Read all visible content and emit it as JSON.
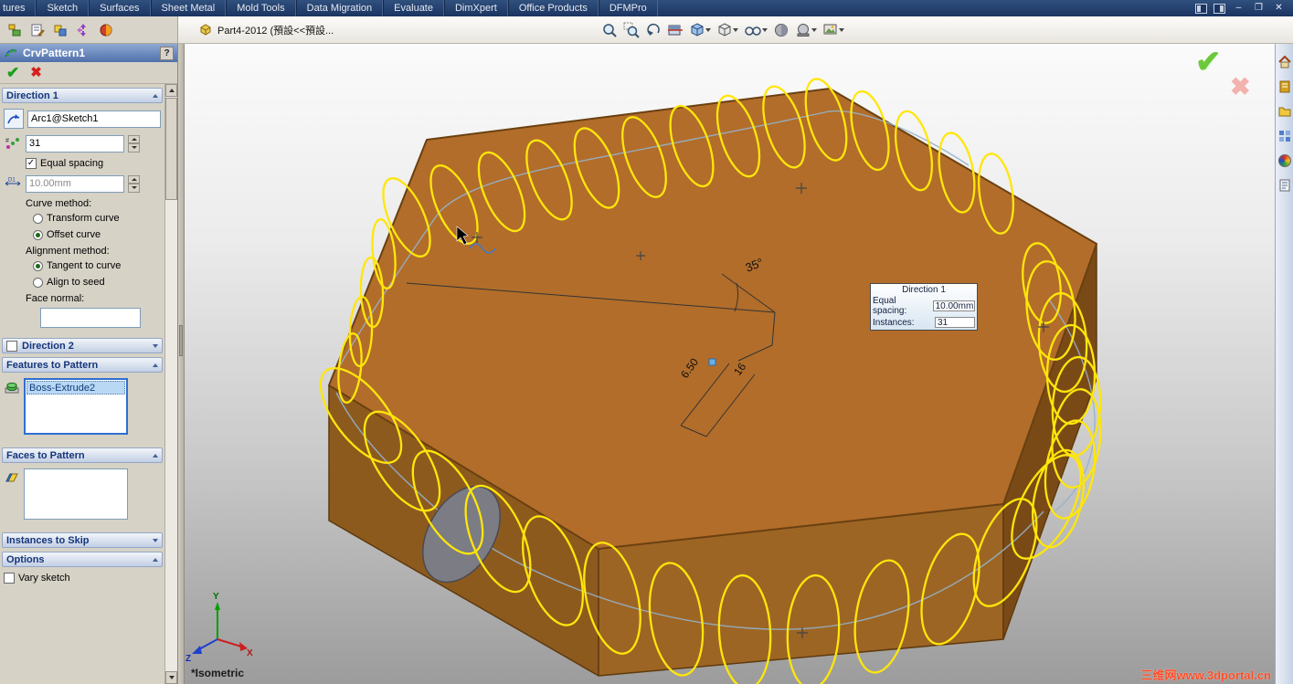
{
  "icons": {
    "check": "✓",
    "ok": "✔",
    "cancel": "✖",
    "close": "✕",
    "minimize": "–",
    "restore": "❐",
    "help": "?"
  },
  "menu": {
    "tabs": [
      "tures",
      "Sketch",
      "Surfaces",
      "Sheet Metal",
      "Mold Tools",
      "Data Migration",
      "Evaluate",
      "DimXpert",
      "Office Products",
      "DFMPro"
    ]
  },
  "toolbar": {
    "doc_title": "Part4-2012 (預設<<預設..."
  },
  "pm": {
    "title": "CrvPattern1",
    "direction1": {
      "header": "Direction 1",
      "curve": "Arc1@Sketch1",
      "instances": "31",
      "equal_spacing": "Equal spacing",
      "spacing": "10.00mm",
      "curve_method": "Curve method:",
      "transform_curve": "Transform curve",
      "offset_curve": "Offset curve",
      "alignment_method": "Alignment method:",
      "tangent_to_curve": "Tangent to curve",
      "align_to_seed": "Align to seed",
      "face_normal": "Face normal:"
    },
    "direction2": {
      "header": "Direction 2"
    },
    "features": {
      "header": "Features to Pattern",
      "items": [
        "Boss-Extrude2"
      ]
    },
    "faces": {
      "header": "Faces to Pattern"
    },
    "skip": {
      "header": "Instances to Skip"
    },
    "options": {
      "header": "Options",
      "vary_sketch": "Vary sketch"
    }
  },
  "viewport": {
    "orientation": "*Isometric",
    "watermark": "三维网www.3dportal.cn",
    "dims": {
      "angle": "35°",
      "length": "16",
      "width": "6.50"
    },
    "triad": {
      "x": "X",
      "y": "Y",
      "z": "Z"
    },
    "tooltip": {
      "title": "Direction 1",
      "spacing_label": "Equal spacing:",
      "spacing_value": "10.00mm",
      "instances_label": "Instances:",
      "instances_value": "31"
    }
  }
}
